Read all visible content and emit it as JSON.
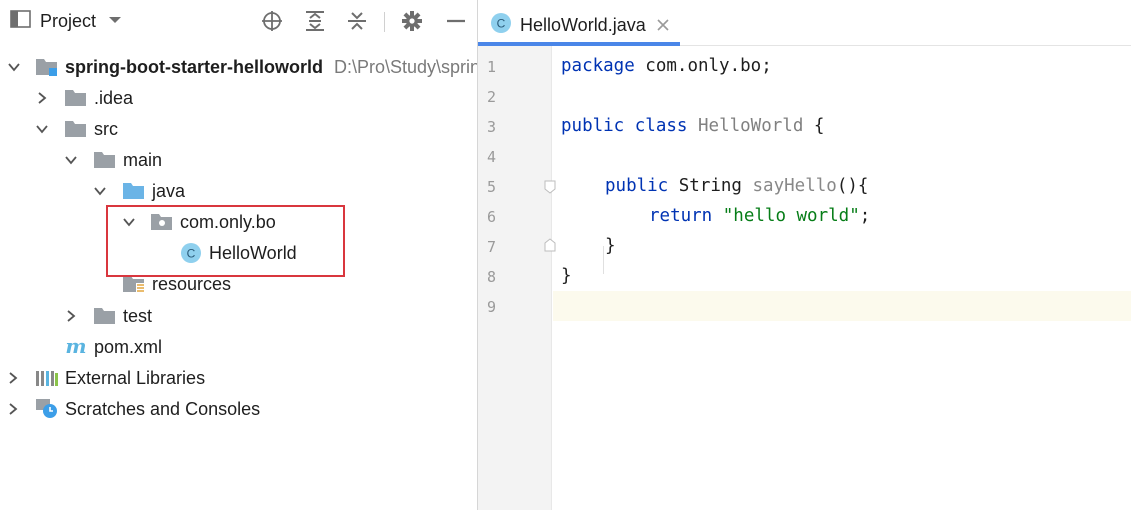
{
  "project_panel": {
    "title": "Project",
    "icons": [
      "folder-window-icon",
      "chevron-down-icon",
      "locate-icon",
      "expand-all-icon",
      "collapse-all-icon",
      "gear-icon",
      "minimize-icon"
    ]
  },
  "tree": [
    {
      "label": "spring-boot-starter-helloworld",
      "path": "D:\\Pro\\Study\\sprin",
      "icon": "module-folder-icon",
      "expanded": true
    },
    {
      "label": ".idea",
      "icon": "folder-icon",
      "expanded": false
    },
    {
      "label": "src",
      "icon": "folder-icon",
      "expanded": true
    },
    {
      "label": "main",
      "icon": "folder-icon",
      "expanded": true
    },
    {
      "label": "java",
      "icon": "source-folder-icon",
      "expanded": true
    },
    {
      "label": "com.only.bo",
      "icon": "package-icon",
      "expanded": true
    },
    {
      "label": "HelloWorld",
      "icon": "java-class-icon"
    },
    {
      "label": "resources",
      "icon": "resources-folder-icon"
    },
    {
      "label": "test",
      "icon": "folder-icon",
      "expanded": false
    },
    {
      "label": "pom.xml",
      "icon": "maven-icon"
    },
    {
      "label": "External Libraries",
      "icon": "libraries-icon",
      "expanded": false
    },
    {
      "label": "Scratches and Consoles",
      "icon": "scratches-icon",
      "expanded": false
    }
  ],
  "editor": {
    "tab": {
      "label": "HelloWorld.java",
      "icon": "java-class-icon"
    },
    "line_numbers": [
      "1",
      "2",
      "3",
      "4",
      "5",
      "6",
      "7",
      "8",
      "9"
    ],
    "current_line": 9,
    "code": {
      "l1_kw": "package",
      "l1_rest": " com.only.bo;",
      "l3_kw1": "public",
      "l3_kw2": "class",
      "l3_cls": "HelloWorld",
      "l3_rest": " {",
      "l5_kw": "public",
      "l5_type": " String ",
      "l5_fn": "sayHello",
      "l5_rest": "(){",
      "l6_kw": "return",
      "l6_str": "\"hello world\"",
      "l6_rest": ";",
      "l7": "}",
      "l8": "}"
    }
  },
  "colors": {
    "keyword": "#0033b3",
    "string": "#067d17",
    "highlight_box": "#d9363e",
    "tab_underline": "#4a86e8",
    "current_line": "#fcfaed"
  }
}
